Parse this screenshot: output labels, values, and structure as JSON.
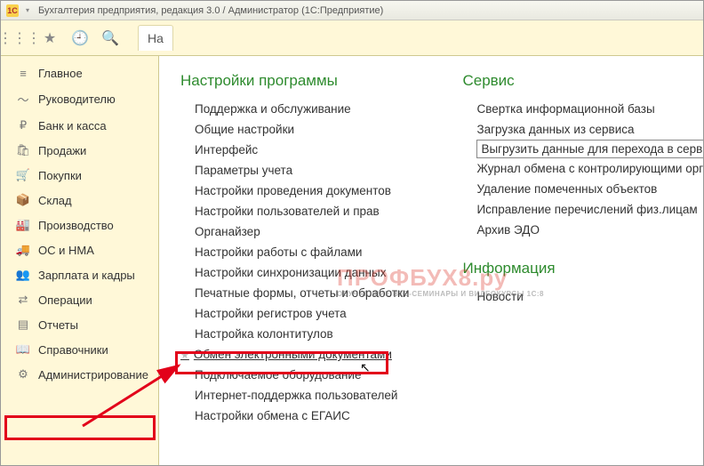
{
  "title_bar": {
    "app_badge": "1C",
    "text": "Бухгалтерия предприятия, редакция 3.0 / Администратор  (1С:Предприятие)"
  },
  "toolbar": {
    "tab_label": "На"
  },
  "sidebar": {
    "items": [
      {
        "icon": "≡",
        "label": "Главное"
      },
      {
        "icon": "〜",
        "label": "Руководителю"
      },
      {
        "icon": "₽",
        "label": "Банк и касса"
      },
      {
        "icon": "🛍",
        "label": "Продажи"
      },
      {
        "icon": "🛒",
        "label": "Покупки"
      },
      {
        "icon": "📦",
        "label": "Склад"
      },
      {
        "icon": "🏭",
        "label": "Производство"
      },
      {
        "icon": "🚚",
        "label": "ОС и НМА"
      },
      {
        "icon": "👥",
        "label": "Зарплата и кадры"
      },
      {
        "icon": "⇄",
        "label": "Операции"
      },
      {
        "icon": "▤",
        "label": "Отчеты"
      },
      {
        "icon": "📖",
        "label": "Справочники"
      },
      {
        "icon": "⚙",
        "label": "Администрирование"
      }
    ]
  },
  "content": {
    "col1": {
      "heading": "Настройки программы",
      "links": [
        "Поддержка и обслуживание",
        "Общие настройки",
        "Интерфейс",
        "Параметры учета",
        "Настройки проведения документов",
        "Настройки пользователей и прав",
        "Органайзер",
        "Настройки работы с файлами",
        "Настройки синхронизации данных",
        "Печатные формы, отчеты и обработки",
        "Настройки регистров учета",
        "Настройка колонтитулов",
        "Обмен электронными документами",
        "Подключаемое оборудование",
        "Интернет-поддержка пользователей",
        "Настройки обмена с ЕГАИС"
      ]
    },
    "col2a": {
      "heading": "Сервис",
      "links": [
        "Свертка информационной базы",
        "Загрузка данных из сервиса",
        "Выгрузить данные для перехода в сервис",
        "Журнал обмена с контролирующими органами",
        "Удаление помеченных объектов",
        "Исправление перечислений физ.лицам",
        "Архив ЭДО"
      ]
    },
    "col2b": {
      "heading": "Информация",
      "links": [
        "Новости"
      ]
    }
  },
  "watermark": {
    "big": "ПРОФБУХ8.ру",
    "small": "ОБУЧАЮЩИЕ ВЕБ-СЕМИНАРЫ И ВИДЕОКУРСЫ 1С:8"
  }
}
